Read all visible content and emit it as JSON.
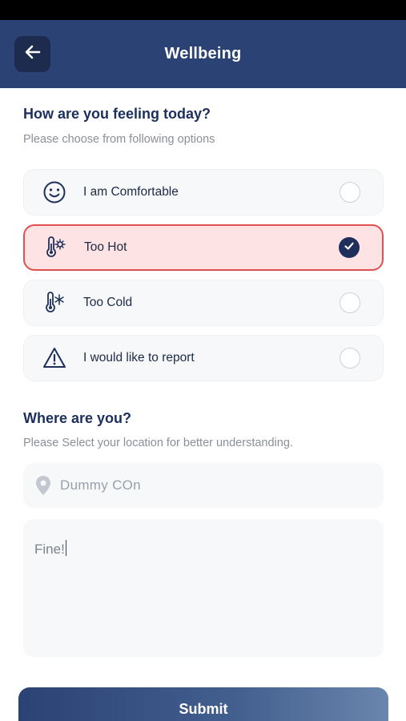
{
  "header": {
    "title": "Wellbeing",
    "back_icon": "arrow-left-icon"
  },
  "feeling": {
    "title": "How are you feeling today?",
    "subtitle": "Please choose from following options",
    "options": [
      {
        "label": "I am Comfortable",
        "icon": "smiley-face-icon",
        "selected": false
      },
      {
        "label": "Too Hot",
        "icon": "thermometer-sun-icon",
        "selected": true
      },
      {
        "label": "Too Cold",
        "icon": "thermometer-snowflake-icon",
        "selected": false
      },
      {
        "label": "I would like to report",
        "icon": "warning-triangle-icon",
        "selected": false
      }
    ]
  },
  "location": {
    "title": "Where are you?",
    "subtitle": "Please Select your location for better understanding.",
    "value": "Dummy COn",
    "icon": "location-pin-icon"
  },
  "notes": {
    "value": "Fine!"
  },
  "submit": {
    "label": "Submit"
  },
  "colors": {
    "primary": "#2b4274",
    "selected_border": "#e05050",
    "selected_bg": "#fde3e3"
  }
}
